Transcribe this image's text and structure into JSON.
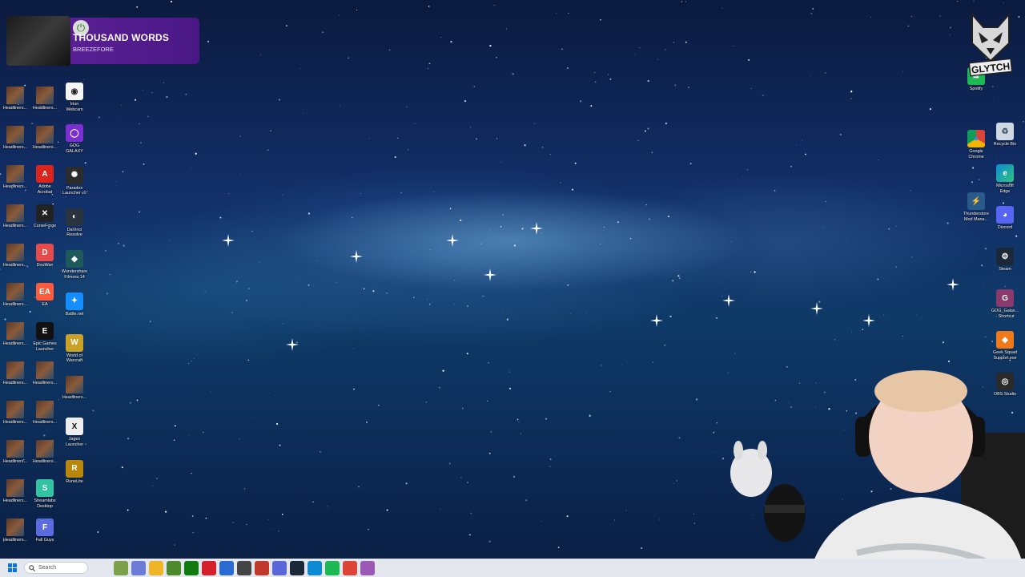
{
  "now_playing": {
    "title": "THOUSAND WORDS",
    "artist": "BREEZEFORE"
  },
  "logo_text": "GLYTCH",
  "desktop_left_col1": [
    {
      "label": "Headliners...",
      "icon": "game-thumbnail"
    },
    {
      "label": "Headliners...",
      "icon": "game-thumbnail"
    },
    {
      "label": "Headliners...",
      "icon": "game-thumbnail"
    },
    {
      "label": "Headliners...",
      "icon": "game-thumbnail"
    },
    {
      "label": "Headliners...",
      "icon": "game-thumbnail"
    },
    {
      "label": "Headliners...",
      "icon": "game-thumbnail"
    },
    {
      "label": "Headliners...",
      "icon": "game-thumbnail"
    },
    {
      "label": "Headliners...",
      "icon": "game-thumbnail"
    },
    {
      "label": "Headliners...",
      "icon": "game-thumbnail"
    },
    {
      "label": "Headliners...",
      "icon": "game-thumbnail"
    },
    {
      "label": "Headliners...",
      "icon": "game-thumbnail"
    },
    {
      "label": "Headliners...",
      "icon": "game-thumbnail"
    }
  ],
  "desktop_left_col2": [
    {
      "label": "Headliners...",
      "icon": "game-thumbnail"
    },
    {
      "label": "Headliners...",
      "icon": "game-thumbnail"
    },
    {
      "label": "Adobe\nAcrobat",
      "icon": "acrobat-icon"
    },
    {
      "label": "CurseForge",
      "icon": "curseforge-icon"
    },
    {
      "label": "DouWan",
      "icon": "douwan-icon"
    },
    {
      "label": "EA",
      "icon": "ea-icon"
    },
    {
      "label": "Epic Games\nLauncher",
      "icon": "epic-games-icon"
    },
    {
      "label": "Headliners...",
      "icon": "game-thumbnail"
    },
    {
      "label": "Headliners...",
      "icon": "game-thumbnail"
    },
    {
      "label": "Headliners...",
      "icon": "game-thumbnail"
    },
    {
      "label": "Streamlabs\nDesktop",
      "icon": "streamlabs-icon"
    },
    {
      "label": "Fall Guys",
      "icon": "fall-guys-icon"
    }
  ],
  "desktop_left_col3": [
    {
      "label": "Iriun\nWebcam",
      "icon": "webcam-icon"
    },
    {
      "label": "GOG\nGALAXY",
      "icon": "gog-icon"
    },
    {
      "label": "Paradox\nLauncher v2",
      "icon": "paradox-icon"
    },
    {
      "label": "DaVinci\nResolve",
      "icon": "davinci-icon"
    },
    {
      "label": "Wondershare\nFilmora 14",
      "icon": "filmora-icon"
    },
    {
      "label": "Battle.net",
      "icon": "battlenet-icon"
    },
    {
      "label": "World of\nWarcraft",
      "icon": "wow-icon"
    },
    {
      "label": "Headliners...",
      "icon": "game-thumbnail"
    },
    {
      "label": "Jagex\nLauncher",
      "icon": "jagex-icon"
    },
    {
      "label": "RuneLite",
      "icon": "runelite-icon"
    }
  ],
  "desktop_right_col1": [
    {
      "label": "Spotify",
      "icon": "spotify-icon"
    },
    {
      "label": "Google\nChrome",
      "icon": "chrome-icon"
    },
    {
      "label": "Thunderstore\nMod Mana...",
      "icon": "thunderstore-icon"
    }
  ],
  "desktop_right_col2": [
    {
      "label": "Recycle Bin",
      "icon": "recycle-bin-icon"
    },
    {
      "label": "Microsoft\nEdge",
      "icon": "edge-icon"
    },
    {
      "label": "Discord",
      "icon": "discord-icon"
    },
    {
      "label": "Steam",
      "icon": "steam-icon"
    },
    {
      "label": "GOG_Galax...\n- Shortcut",
      "icon": "gog-shortcut-icon"
    },
    {
      "label": "Geek Squad\nSupport.exe",
      "icon": "geek-squad-icon"
    },
    {
      "label": "OBS Studio",
      "icon": "obs-icon"
    }
  ],
  "taskbar": {
    "search_placeholder": "Search",
    "apps": [
      {
        "name": "frog-widget-icon",
        "color": "#7da14a"
      },
      {
        "name": "copilot-icon",
        "color": "#6b7bd6"
      },
      {
        "name": "file-explorer-icon",
        "color": "#f0b429"
      },
      {
        "name": "minecraft-icon",
        "color": "#4c8a2c"
      },
      {
        "name": "xbox-icon",
        "color": "#107c10"
      },
      {
        "name": "adobe-icon",
        "color": "#d3202a"
      },
      {
        "name": "store-icon",
        "color": "#2a6bd3"
      },
      {
        "name": "app-icon",
        "color": "#444444"
      },
      {
        "name": "game-icon",
        "color": "#c0392b"
      },
      {
        "name": "browser-icon",
        "color": "#5a67d8"
      },
      {
        "name": "steam-icon",
        "color": "#1b2838"
      },
      {
        "name": "edge-icon",
        "color": "#0c8bd3"
      },
      {
        "name": "spotify-icon",
        "color": "#1db954"
      },
      {
        "name": "chrome-icon",
        "color": "#db4437"
      },
      {
        "name": "streaming-app-icon",
        "color": "#9b59b6"
      }
    ]
  }
}
